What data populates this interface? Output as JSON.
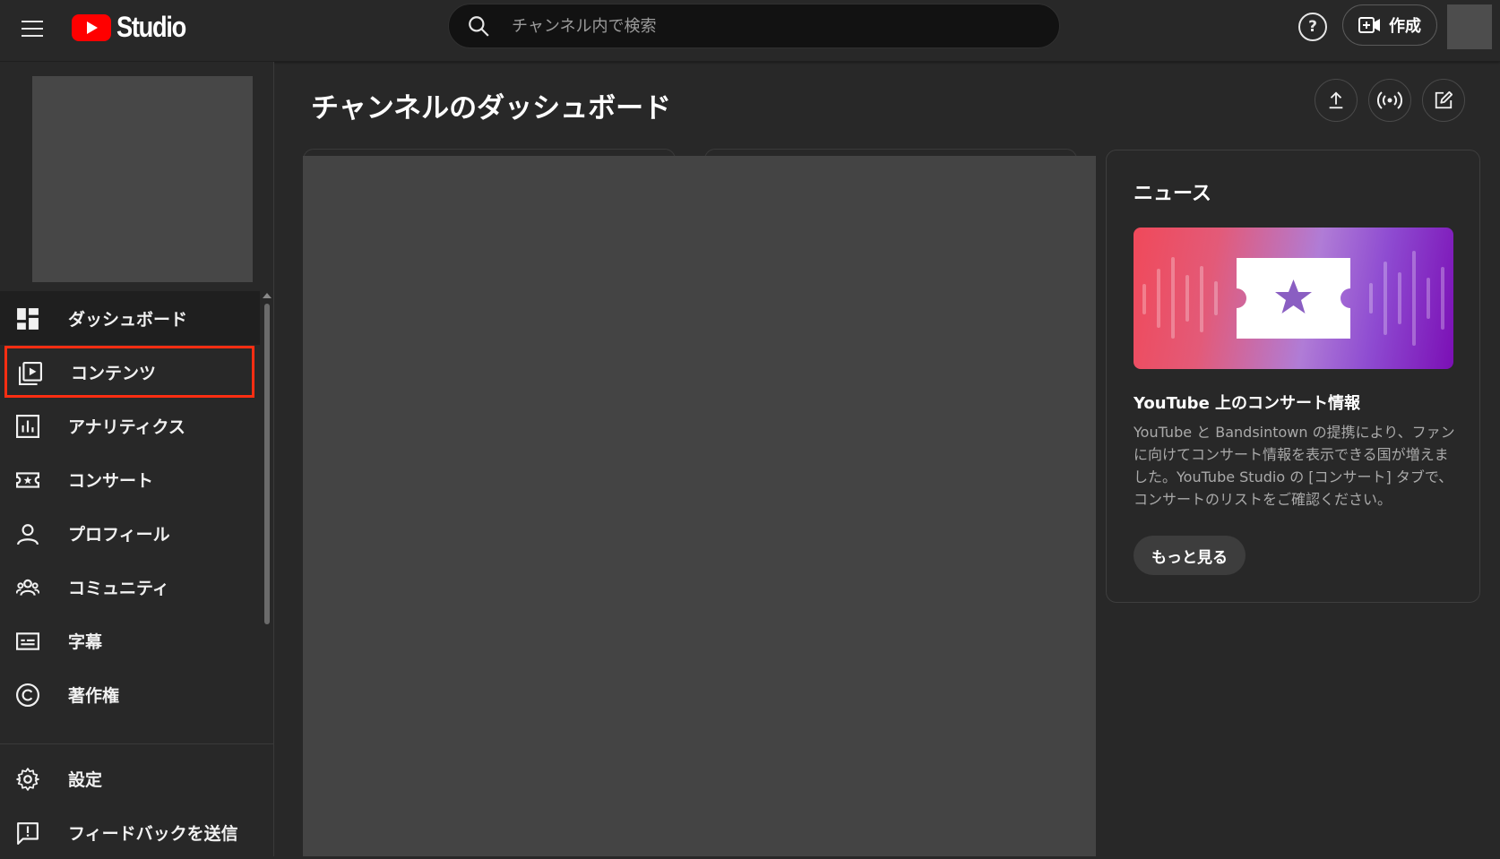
{
  "topbar": {
    "logo_text": "Studio",
    "search_placeholder": "チャンネル内で検索",
    "help_label": "?",
    "create_label": "作成"
  },
  "sidebar": {
    "items": [
      {
        "label": "ダッシュボード",
        "icon": "dashboard-icon",
        "state": "selected"
      },
      {
        "label": "コンテンツ",
        "icon": "content-icon",
        "state": "highlighted"
      },
      {
        "label": "アナリティクス",
        "icon": "analytics-icon"
      },
      {
        "label": "コンサート",
        "icon": "concert-ticket-icon"
      },
      {
        "label": "プロフィール",
        "icon": "profile-icon"
      },
      {
        "label": "コミュニティ",
        "icon": "community-icon"
      },
      {
        "label": "字幕",
        "icon": "subtitles-icon"
      },
      {
        "label": "著作権",
        "icon": "copyright-icon"
      }
    ],
    "bottom_items": [
      {
        "label": "設定",
        "icon": "gear-icon"
      },
      {
        "label": "フィードバックを送信",
        "icon": "feedback-icon"
      }
    ]
  },
  "main": {
    "title": "チャンネルのダッシュボード",
    "actions": [
      "upload-icon",
      "live-icon",
      "edit-icon"
    ]
  },
  "news": {
    "title": "ニュース",
    "headline": "YouTube 上のコンサート情報",
    "body": "YouTube と Bandsintown の提携により、ファンに向けてコンサート情報を表示できる国が増えました。YouTube Studio の [コンサート] タブで、コンサートのリストをご確認ください。",
    "button_label": "もっと見る"
  },
  "colors": {
    "background": "#282828",
    "accent_red": "#ff0000",
    "highlight_border": "#ff2e12"
  }
}
